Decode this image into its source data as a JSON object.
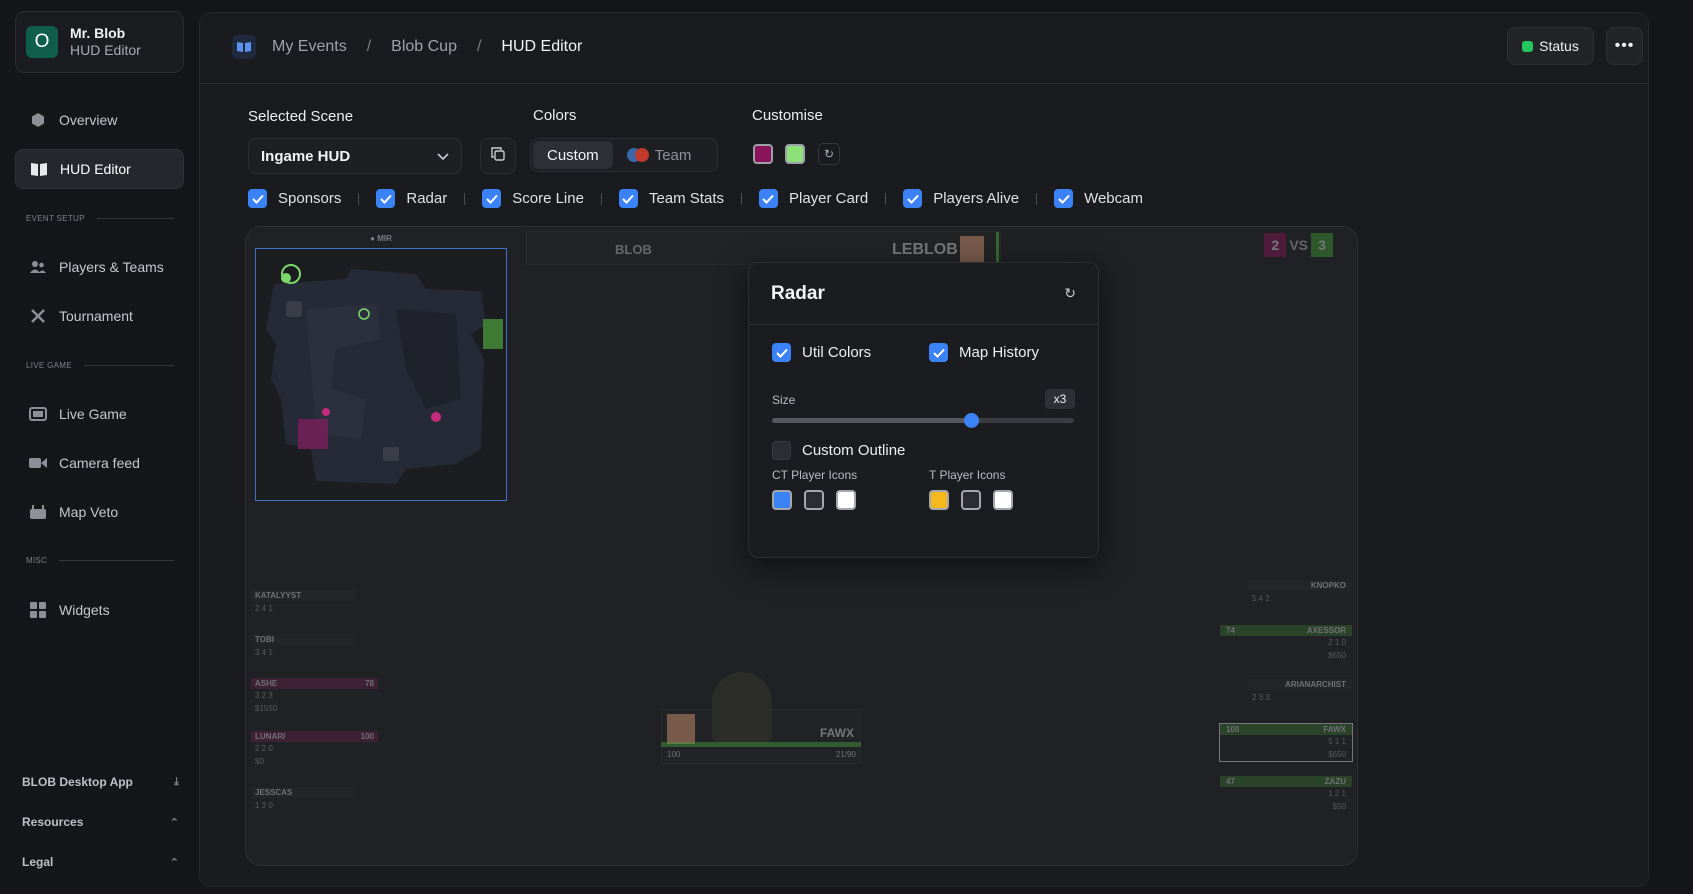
{
  "brand": {
    "initial": "O",
    "name": "Mr. Blob",
    "subtitle": "HUD Editor"
  },
  "nav": {
    "overview": "Overview",
    "hud_editor": "HUD Editor",
    "section_event_setup": "EVENT SETUP",
    "players_teams": "Players & Teams",
    "tournament": "Tournament",
    "section_live_game": "LIVE GAME",
    "live_game": "Live Game",
    "camera_feed": "Camera feed",
    "map_veto": "Map Veto",
    "section_misc": "MISC",
    "widgets": "Widgets"
  },
  "footer": {
    "desktop_app": "BLOB Desktop App",
    "resources": "Resources",
    "legal": "Legal"
  },
  "breadcrumb": [
    "My Events",
    "Blob Cup",
    "HUD Editor"
  ],
  "header": {
    "status": "Status",
    "more": "•••"
  },
  "scene": {
    "label": "Selected Scene",
    "value": "Ingame HUD"
  },
  "colors": {
    "label": "Colors",
    "custom": "Custom",
    "team": "Team",
    "t_color": "#8a1459",
    "ct_color": "#8ee07a",
    "accent": "#3b82f6"
  },
  "customise": {
    "label": "Customise"
  },
  "toggles": [
    "Sponsors",
    "Radar",
    "Score Line",
    "Team Stats",
    "Player Card",
    "Players Alive",
    "Webcam"
  ],
  "preview": {
    "map_name": "MIR",
    "team_right": "LEBLOB",
    "team_left": "BLOB",
    "vs": "VS",
    "score_left": "2",
    "score_right": "3",
    "left_players": [
      {
        "name": "KATALYYST",
        "stats": "2  4  1",
        "type": "dead"
      },
      {
        "name": "TOBI",
        "stats": "3  4  1",
        "type": "dead"
      },
      {
        "name": "ASHE",
        "stats": "3  2  3",
        "hp": "78",
        "money": "$1550",
        "type": "t"
      },
      {
        "name": "LUNARI",
        "stats": "2  2  0",
        "hp": "100",
        "money": "$0",
        "type": "t"
      },
      {
        "name": "JESSCAS",
        "stats": "1  3  0",
        "type": "dead"
      }
    ],
    "right_players": [
      {
        "name": "KNOPKO",
        "stats": "5  4  2",
        "type": "dead"
      },
      {
        "name": "AXESSOR",
        "stats": "2  1  0",
        "hp": "74",
        "money": "$650",
        "type": "ct"
      },
      {
        "name": "ARIANARCHIST",
        "stats": "2  3  3",
        "type": "dead"
      },
      {
        "name": "FAWX",
        "stats": "5  1  1",
        "hp": "100",
        "money": "$650",
        "type": "ct"
      },
      {
        "name": "ZAZU",
        "stats": "1  2  1",
        "hp": "47",
        "money": "$50",
        "type": "ct"
      }
    ],
    "observed": {
      "name": "FAWX",
      "hp": "100",
      "ammo": "21/90"
    }
  },
  "radar_popup": {
    "title": "Radar",
    "util_colors": "Util Colors",
    "map_history": "Map History",
    "size_label": "Size",
    "size_value": "x3",
    "size_fraction": 0.66,
    "custom_outline": "Custom Outline",
    "ct_icons": "CT Player Icons",
    "t_icons": "T Player Icons",
    "ct_colors": [
      "#3b82f6",
      "#2b2d31",
      "#ffffff"
    ],
    "t_colors": [
      "#f5b81d",
      "#2b2d31",
      "#ffffff"
    ]
  }
}
